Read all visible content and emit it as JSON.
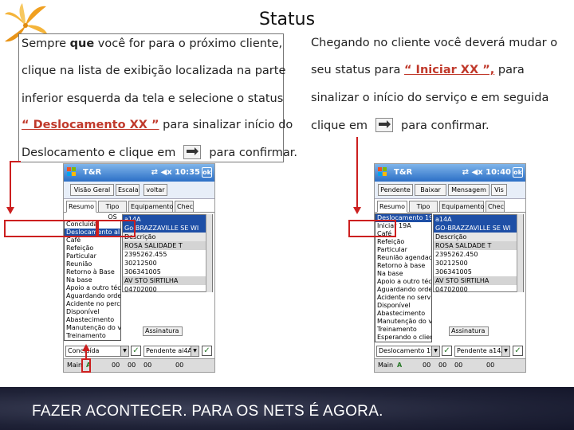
{
  "title": "Status",
  "left_text": {
    "line1_pre": "Sempre ",
    "line1_bold": "que",
    "line1_post": " você for para o próximo cliente,",
    "line2": "clique na lista de exibição localizada na parte",
    "line3": "inferior esquerda da tela e selecione o status",
    "line4_highlight": "“ Deslocamento XX ”",
    "line4_post": " para sinalizar início do",
    "line5_pre": "Deslocamento e clique em",
    "line5_post": "para confirmar."
  },
  "right_text": {
    "line1": "Chegando no cliente você deverá mudar o",
    "line2_pre": "seu status para ",
    "line2_highlight": "“ Iniciar XX ”,",
    "line2_post": " para",
    "line3": "sinalizar o início do serviço e em seguida",
    "line4_pre": "clique em",
    "line4_post": "para confirmar."
  },
  "phone_left": {
    "app_name": "T&R",
    "status_time": "⇄ ◀x 10:35",
    "close": "ok",
    "top_buttons": [
      "Visão Geral",
      "Escala",
      "voltar"
    ],
    "tabs": [
      "Resumo",
      "Tipo OS",
      "Equipamento",
      "Chec"
    ],
    "dropdown_items": [
      "Concluída",
      "Deslocamento ali 4A",
      "Café",
      "Refeição",
      "Particular",
      "Reunião",
      "Retorno à Base",
      "Na base",
      "Apoio a outro técn",
      "Aguardando ordem",
      "Acidente no percurso",
      "Disponível",
      "Abastecimento",
      "Manutenção do veí",
      "Treinamento"
    ],
    "table_rows": [
      "a14A",
      "Go-BRAZZAVILLE SE WI",
      "Descrição",
      "ROSA SALIDADE T",
      "2395262.455",
      "30212500",
      "306341005",
      "AV STO SIRTILHA",
      "04702000"
    ],
    "subtabs": [
      "Assinatura"
    ],
    "select_value": "Concluída",
    "select_value2": "Pendente ai4A",
    "taskbar": [
      "Main",
      "A",
      "00",
      "00",
      "00",
      "00"
    ]
  },
  "phone_right": {
    "app_name": "T&R",
    "status_time": "⇄ ◀x 10:40",
    "close": "ok",
    "top_buttons": [
      "Pendente",
      "Baixar",
      "Mensagem",
      "Vis"
    ],
    "tabs": [
      "Resumo",
      "Tipo OS",
      "Equipamento",
      "Chec"
    ],
    "dropdown_items": [
      "Deslocamento 19A",
      "Iniciar 19A",
      "Café",
      "Refeição",
      "Particular",
      "Reunião agendada",
      "Retorno à base",
      "Na base",
      "Apoio a outro téc",
      "Aguardando ordem",
      "Acidente no serviço",
      "Disponível",
      "Abastecimento",
      "Manutenção do ve",
      "Treinamento",
      "Esperando o client"
    ],
    "table_rows": [
      "a14A",
      "GO-BRAZZAVILLE SE WI",
      "Descrição",
      "ROSA SALDADE T",
      "2395262.450",
      "30212500",
      "306341005",
      "AV STO SIRTILHA",
      "04702000"
    ],
    "subtabs": [
      "Assinatura"
    ],
    "select_value": "Deslocamento 19A",
    "select_value2": "Pendente a14A",
    "taskbar": [
      "Main",
      "A",
      "00",
      "00",
      "00",
      "00"
    ]
  },
  "footer": "FAZER ACONTECER. PARA OS NETS É AGORA.",
  "colors": {
    "highlight": "#c0392b",
    "marker": "#cc1f1f",
    "logo": "#f0a020",
    "footer_bg": "#1f2237"
  }
}
